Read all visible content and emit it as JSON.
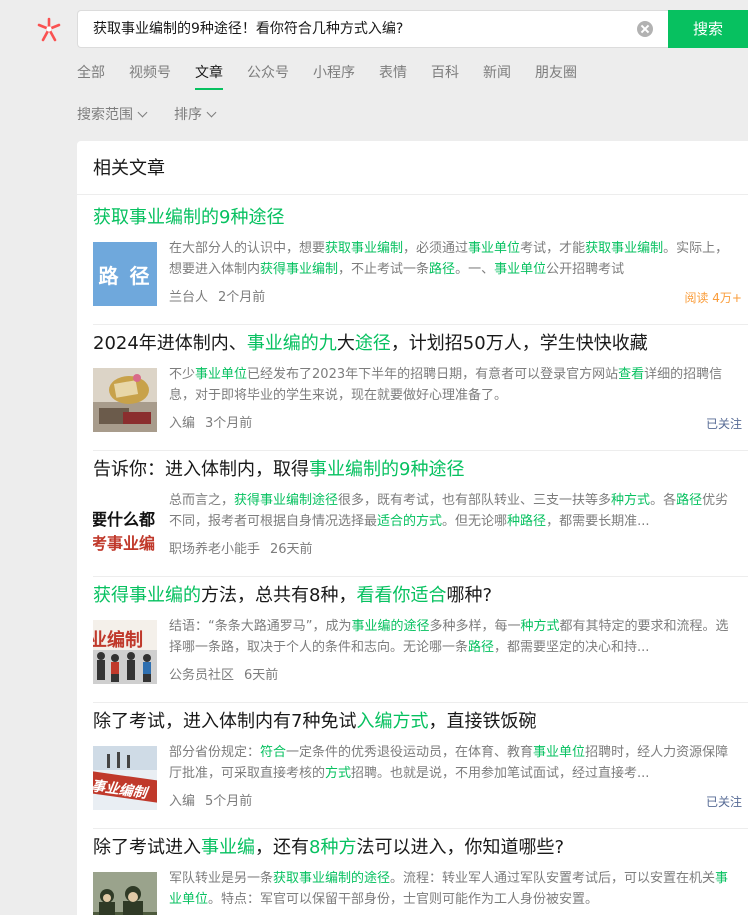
{
  "search": {
    "query": "获取事业编制的9种途径！看你符合几种方式入编?",
    "button_label": "搜索"
  },
  "tabs": [
    {
      "label": "全部",
      "active": false
    },
    {
      "label": "视频号",
      "active": false
    },
    {
      "label": "文章",
      "active": true
    },
    {
      "label": "公众号",
      "active": false
    },
    {
      "label": "小程序",
      "active": false
    },
    {
      "label": "表情",
      "active": false
    },
    {
      "label": "百科",
      "active": false
    },
    {
      "label": "新闻",
      "active": false
    },
    {
      "label": "朋友圈",
      "active": false
    }
  ],
  "filters": [
    {
      "label": "搜索范围"
    },
    {
      "label": "排序"
    }
  ],
  "results": {
    "heading": "相关文章",
    "articles": [
      {
        "title_parts": [
          [
            "获取事业编制的9种途径",
            true
          ]
        ],
        "desc_parts": [
          [
            "在大部分人的认识中，想要",
            false
          ],
          [
            "获取事业编制",
            true
          ],
          [
            "，必须通过",
            false
          ],
          [
            "事业单位",
            true
          ],
          [
            "考试，才能",
            false
          ],
          [
            "获取事业编制",
            true
          ],
          [
            "。实际上，想要进入体制内",
            false
          ],
          [
            "获得事业编制",
            true
          ],
          [
            "，不止考试一条",
            false
          ],
          [
            "路径",
            true
          ],
          [
            "。一、",
            false
          ],
          [
            "事业单位",
            true
          ],
          [
            "公开招聘考试",
            false
          ]
        ],
        "source": "兰台人",
        "time": "2个月前",
        "tag": "阅读 4万+",
        "tag_color": "#fa9d3b",
        "thumb": {
          "kind": "text-on-blue",
          "text": "路 径",
          "bg": "#6fa8dc"
        }
      },
      {
        "title_parts": [
          [
            "2024年进体制内、",
            false
          ],
          [
            "事业编的九",
            true
          ],
          [
            "大",
            false
          ],
          [
            "途径",
            true
          ],
          [
            "，计划招50万人，学生快快收藏",
            false
          ]
        ],
        "desc_parts": [
          [
            "不少",
            false
          ],
          [
            "事业单位",
            true
          ],
          [
            "已经发布了2023年下半年的招聘日期，有意者可以登录官方网站",
            false
          ],
          [
            "查看",
            true
          ],
          [
            "详细的招聘信息，对于即将毕业的学生来说，现在就要做好心理准备了。",
            false
          ]
        ],
        "source": "入编",
        "time": "3个月前",
        "tag": "已关注",
        "tag_color": "#576b95",
        "thumb": {
          "kind": "photo-books"
        }
      },
      {
        "title_parts": [
          [
            "告诉你：进入体制内，取得",
            false
          ],
          [
            "事业编制的9种途径",
            true
          ]
        ],
        "desc_parts": [
          [
            "总而言之，",
            false
          ],
          [
            "获得事业编制途径",
            true
          ],
          [
            "很多，既有考试，也有部队转业、三支一扶等多",
            false
          ],
          [
            "种方式",
            true
          ],
          [
            "。各",
            false
          ],
          [
            "路径",
            true
          ],
          [
            "优劣不同，报考者可根据自身情况选择最",
            false
          ],
          [
            "适合的方式",
            true
          ],
          [
            "。但无论哪",
            false
          ],
          [
            "种路径",
            true
          ],
          [
            "，都需要长期准...",
            false
          ]
        ],
        "source": "职场养老小能手",
        "time": "26天前",
        "tag": "",
        "tag_color": "#576b95",
        "thumb": {
          "kind": "text-black",
          "text1": "要什么都",
          "text2": "考事业编"
        }
      },
      {
        "title_parts": [
          [
            "获得事业编的",
            true
          ],
          [
            "方法，总共有8种，",
            false
          ],
          [
            "看看你适合",
            true
          ],
          [
            "哪种?",
            false
          ]
        ],
        "desc_parts": [
          [
            "结语：“条条大路通罗马”，成为",
            false
          ],
          [
            "事业编的途径",
            true
          ],
          [
            "多种多样，每一",
            false
          ],
          [
            "种方式",
            true
          ],
          [
            "都有其特定的要求和流程。选择哪一条路，取决于个人的条件和志向。无论哪一条",
            false
          ],
          [
            "路径",
            true
          ],
          [
            "，都需要坚定的决心和持...",
            false
          ]
        ],
        "source": "公务员社区",
        "time": "6天前",
        "tag": "",
        "tag_color": "#576b95",
        "thumb": {
          "kind": "text-red-crowd",
          "text": "业编制"
        }
      },
      {
        "title_parts": [
          [
            "除了考试，进入体制内有7种免试",
            false
          ],
          [
            "入编方式",
            true
          ],
          [
            "，直接铁饭碗",
            false
          ]
        ],
        "desc_parts": [
          [
            "部分省份规定：",
            false
          ],
          [
            "符合",
            true
          ],
          [
            "一定条件的优秀退役运动员，在体育、教育",
            false
          ],
          [
            "事业单位",
            true
          ],
          [
            "招聘时，经人力资源保障厅批准，可采取直接考核的",
            false
          ],
          [
            "方式",
            true
          ],
          [
            "招聘。也就是说，不用参加笔试面试，经过直接考...",
            false
          ]
        ],
        "source": "入编",
        "time": "5个月前",
        "tag": "已关注",
        "tag_color": "#576b95",
        "thumb": {
          "kind": "text-red-band",
          "text": "事业编制"
        }
      },
      {
        "title_parts": [
          [
            "除了考试进入",
            false
          ],
          [
            "事业编",
            true
          ],
          [
            "，还有",
            false
          ],
          [
            "8种方",
            true
          ],
          [
            "法可以进入，你知道哪些?",
            false
          ]
        ],
        "desc_parts": [
          [
            "军队转业是另一条",
            false
          ],
          [
            "获取事业编制的途径",
            true
          ],
          [
            "。流程：转业军人通过军队安置考试后，可以安置在机关",
            false
          ],
          [
            "事业单位",
            true
          ],
          [
            "。特点：军官可以保留干部身份，士官则可能作为工人身份被安置。",
            false
          ]
        ],
        "source": "",
        "time": "",
        "tag": "",
        "tag_color": "#576b95",
        "thumb": {
          "kind": "photo-soldiers"
        }
      }
    ]
  },
  "colors": {
    "accent": "#07c160",
    "muted": "#7d7d7d",
    "logo": "#fa5151"
  }
}
